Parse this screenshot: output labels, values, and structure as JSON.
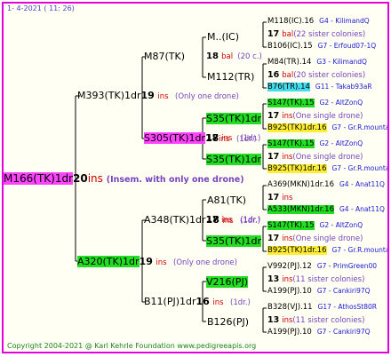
{
  "header": {
    "date": "1-   4-2021  ( 11:  26)"
  },
  "footer": {
    "copyright": "Copyright 2004-2021 @ Karl Kehrle Foundation    www.pedigreeapis.org"
  },
  "root": {
    "name": "M166(TK)1dr",
    "num": "20",
    "ins": "ins",
    "note": "(Insem. with only one drone)"
  },
  "g1": {
    "upper": {
      "name": "M393(TK)1dr",
      "num": "19",
      "ins": "ins",
      "note": "(Only one drone)"
    },
    "lower": {
      "name": "A320(TK)1dr",
      "num": "19",
      "ins": "ins",
      "note": "(Only one drone)"
    }
  },
  "g2": {
    "a": {
      "name": "M87(TK)"
    },
    "b": {
      "name": "S305(TK)1dr",
      "num": "18",
      "ins": "ins",
      "note": "(1dr.)"
    },
    "c": {
      "name": "A348(TK)1dr",
      "num": "18",
      "ins": "ins",
      "note": "(1dr.)"
    },
    "d": {
      "name": "B11(PJ)1dr",
      "num": "16",
      "ins": "ins",
      "note": "(1dr.)"
    }
  },
  "g3": {
    "a1": {
      "name": "M..(IC)"
    },
    "m_num": "18",
    "m_bal": "bal",
    "m_note": "(20 c.)",
    "a2": {
      "name": "M112(TR)"
    },
    "b1": {
      "name": "S35(TK)1dr"
    },
    "b_num": "17",
    "b_ins": "ins",
    "b_note": "(1dr.)",
    "b2": {
      "name": "S35(TK)1dr"
    },
    "c1": {
      "name": "A81(TK)"
    },
    "c_num": "17",
    "c_ins": "ins",
    "c_note": "(1dr.)",
    "c2": {
      "name": "S35(TK)1dr"
    },
    "d1": {
      "name": "V216(PJ)"
    },
    "d2": {
      "name": "B126(PJ)"
    }
  },
  "g4": [
    {
      "type": "gp",
      "name": "M118(IC).16",
      "info": "G4 - KilimandQ"
    },
    {
      "type": "stat",
      "num": "17",
      "word": "bal",
      "note": "(22 sister colonies)"
    },
    {
      "type": "gp",
      "name": "B106(IC).15",
      "info": "G7 - Erfoud07-1Q"
    },
    {
      "type": "gp",
      "name": "M84(TR).14",
      "info": "G3 - KilimandQ"
    },
    {
      "type": "stat",
      "num": "16",
      "word": "bal",
      "note": "(20 sister colonies)"
    },
    {
      "type": "gp",
      "name": "B76(TR).14",
      "info": "G11 - Takab93aR",
      "hl": "cyan"
    },
    {
      "type": "gp",
      "name": "S147(TK).15",
      "info": "G2 - AltZonQ",
      "hl": "green"
    },
    {
      "type": "stat",
      "num": "17",
      "word": "ins",
      "note": "(One single drone)"
    },
    {
      "type": "gp",
      "name": "B925(TK)1dr.16",
      "info": "G7 - Gr.R.mounta",
      "hl": "yellow"
    },
    {
      "type": "gp",
      "name": "S147(TK).15",
      "info": "G2 - AltZonQ",
      "hl": "green"
    },
    {
      "type": "stat",
      "num": "17",
      "word": "ins",
      "note": "(One single drone)"
    },
    {
      "type": "gp",
      "name": "B925(TK)1dr.16",
      "info": "G7 - Gr.R.mounta",
      "hl": "yellow"
    },
    {
      "type": "gp",
      "name": "A369(MKN)1dr.16",
      "info": "G4 - Anat11Q"
    },
    {
      "type": "stat",
      "num": "17",
      "word": "ins",
      "note": ""
    },
    {
      "type": "gp",
      "name": "A533(MKN)1dr.16",
      "info": "G4 - Anat11Q",
      "hl": "green"
    },
    {
      "type": "gp",
      "name": "S147(TK).15",
      "info": "G2 - AltZonQ",
      "hl": "green"
    },
    {
      "type": "stat",
      "num": "17",
      "word": "ins",
      "note": "(One single drone)"
    },
    {
      "type": "gp",
      "name": "B925(TK)1dr.16",
      "info": "G7 - Gr.R.mounta",
      "hl": "yellow"
    },
    {
      "type": "gp",
      "name": "V992(PJ).12",
      "info": "G7 - PrimGreen00"
    },
    {
      "type": "stat",
      "num": "13",
      "word": "ins",
      "note": "(11 sister colonies)"
    },
    {
      "type": "gp",
      "name": "A199(PJ).10",
      "info": "G7 - Cankiri97Q"
    },
    {
      "type": "gp",
      "name": "B328(VJ).11",
      "info": "G17 - AthosSt80R"
    },
    {
      "type": "stat",
      "num": "13",
      "word": "ins",
      "note": "(11 sister colonies)"
    },
    {
      "type": "gp",
      "name": "A199(PJ).10",
      "info": "G7 - Cankiri97Q"
    }
  ]
}
